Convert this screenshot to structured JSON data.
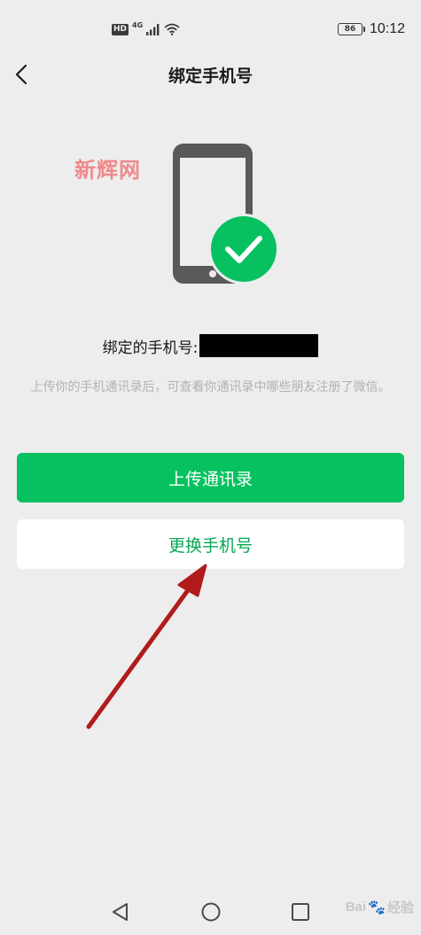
{
  "status_bar": {
    "hd_label": "HD",
    "network_label": "4G",
    "battery_level": "86",
    "time": "10:12"
  },
  "nav": {
    "title": "绑定手机号",
    "back_icon": "chevron-left-icon"
  },
  "watermark_top": "新辉网",
  "illustration": {
    "phone_icon": "smartphone-icon",
    "check_icon": "checkmark-circle-icon",
    "phone_color": "#595959",
    "check_bg_color": "#07c160"
  },
  "binding": {
    "label": "绑定的手机号:",
    "number_redacted": true
  },
  "hint": "上传你的手机通讯录后，可查看你通讯录中哪些朋友注册了微信。",
  "buttons": {
    "upload_contacts": "上传通讯录",
    "change_number": "更换手机号"
  },
  "colors": {
    "accent": "#07c160",
    "background": "#ededed",
    "hint_text": "#b2b2b2",
    "annotation_arrow": "#b01c1c"
  },
  "system_nav": {
    "back_icon": "triangle-back-icon",
    "home_icon": "circle-home-icon",
    "recent_icon": "square-recent-icon"
  },
  "watermark_bottom": {
    "brand": "Bai",
    "suffix": "经验"
  }
}
